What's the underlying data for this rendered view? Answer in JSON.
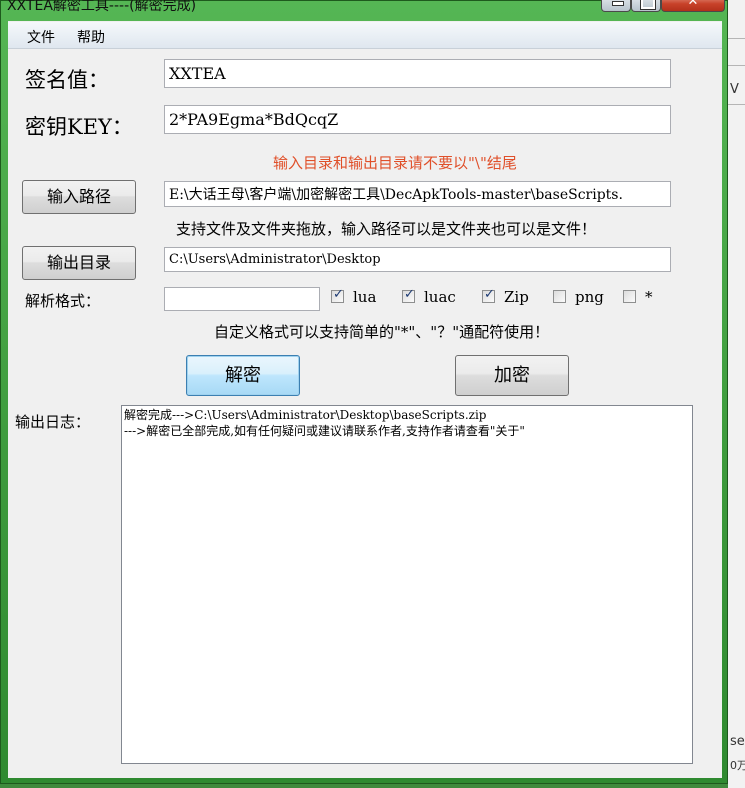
{
  "window": {
    "title": "XXTEA解密工具----(解密完成)",
    "controls": {
      "min": "—",
      "close": "✕"
    }
  },
  "menu": [
    "文件",
    "帮助"
  ],
  "form": {
    "signature_label": "签名值：",
    "signature_value": "XXTEA",
    "key_label": "密钥KEY：",
    "key_value": "2*PA9Egma*BdQcqZ",
    "warning": "输入目录和输出目录请不要以\"\\\"结尾",
    "input_button": "输入路径",
    "input_path": "E:\\大话王母\\客户端\\加密解密工具\\DecApkTools-master\\baseScripts.",
    "input_hint": "支持文件及文件夹拖放，输入路径可以是文件夹也可以是文件！",
    "output_button": "输出目录",
    "output_path": "C:\\Users\\Administrator\\Desktop",
    "format_label": "解析格式：",
    "format_value": "",
    "wildcard_hint": "自定义格式可以支持简单的\"*\"、\"？\"通配符使用！",
    "decrypt_button": "解密",
    "encrypt_button": "加密",
    "log_label": "输出日志："
  },
  "formats": [
    {
      "label": "lua",
      "checked": true
    },
    {
      "label": "luac",
      "checked": true
    },
    {
      "label": "Zip",
      "checked": true
    },
    {
      "label": "png",
      "checked": false
    },
    {
      "label": "*",
      "checked": false
    }
  ],
  "log_lines": [
    "解密完成--->C:\\Users\\Administrator\\Desktop\\baseScripts.zip",
    "--->解密已全部完成,如有任何疑问或建议请联系作者,支持作者请查看\"关于\""
  ],
  "background_text": [
    "V",
    "se",
    "0万"
  ],
  "colors": {
    "warning": "#e0502a",
    "frame": "#45a845"
  }
}
